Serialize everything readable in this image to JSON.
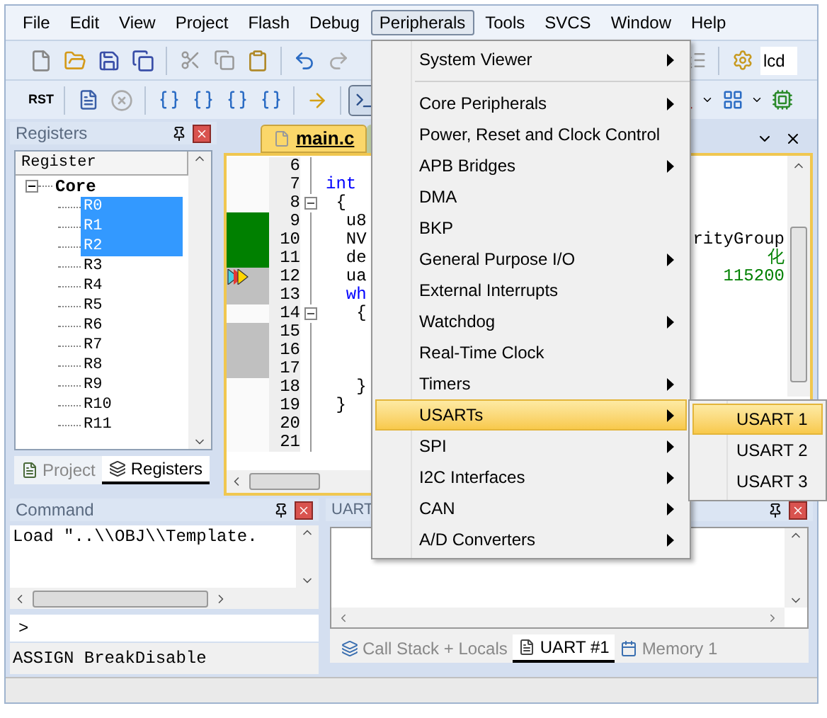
{
  "menu_bar": [
    {
      "label": "File",
      "open": false
    },
    {
      "label": "Edit",
      "open": false
    },
    {
      "label": "View",
      "open": false
    },
    {
      "label": "Project",
      "open": false
    },
    {
      "label": "Flash",
      "open": false
    },
    {
      "label": "Debug",
      "open": false
    },
    {
      "label": "Peripherals",
      "open": true
    },
    {
      "label": "Tools",
      "open": false
    },
    {
      "label": "SVCS",
      "open": false
    },
    {
      "label": "Window",
      "open": false
    },
    {
      "label": "Help",
      "open": false
    }
  ],
  "toolbar": {
    "reset_label": "RST",
    "target_field": {
      "value": "lcd"
    }
  },
  "registers_panel": {
    "title": "Registers",
    "column": "Register",
    "tree": [
      {
        "label": "Core",
        "expanded": true,
        "children": [
          {
            "label": "R0",
            "selected": true
          },
          {
            "label": "R1",
            "selected": true
          },
          {
            "label": "R2",
            "selected": true
          },
          {
            "label": "R3",
            "selected": false
          },
          {
            "label": "R4",
            "selected": false
          },
          {
            "label": "R5",
            "selected": false
          },
          {
            "label": "R6",
            "selected": false
          },
          {
            "label": "R7",
            "selected": false
          },
          {
            "label": "R8",
            "selected": false
          },
          {
            "label": "R9",
            "selected": false
          },
          {
            "label": "R10",
            "selected": false
          },
          {
            "label": "R11",
            "selected": false
          }
        ]
      }
    ],
    "tabs": [
      {
        "label": "Project",
        "selected": false
      },
      {
        "label": "Registers",
        "selected": true
      }
    ]
  },
  "editor": {
    "tabs": [
      {
        "label": "main.c",
        "selected": true
      }
    ],
    "lines": [
      {
        "number": "6",
        "executed": false,
        "skipped": false,
        "current": false
      },
      {
        "number": "7",
        "code": "int",
        "kind": "keyword",
        "executed": false,
        "skipped": false,
        "current": false
      },
      {
        "number": "8",
        "code": " {",
        "fold": true,
        "executed": false,
        "skipped": false,
        "current": false
      },
      {
        "number": "9",
        "code": "  u8",
        "executed": true,
        "skipped": false,
        "current": false
      },
      {
        "number": "10",
        "code": "  NV",
        "executed": true,
        "skipped": false,
        "current": false,
        "tail": {
          "text": "rityGroup",
          "kind": "plain"
        }
      },
      {
        "number": "11",
        "code": "  de",
        "executed": true,
        "skipped": false,
        "current": false,
        "tail": {
          "text": "化",
          "kind": "comment"
        }
      },
      {
        "number": "12",
        "code": "  ua",
        "executed": false,
        "skipped": true,
        "current": true,
        "tail": {
          "text": "115200",
          "kind": "comment"
        }
      },
      {
        "number": "13",
        "code": "  wh",
        "kind": "keyword",
        "executed": false,
        "skipped": true,
        "current": false
      },
      {
        "number": "14",
        "code": "   {",
        "fold": true,
        "executed": false,
        "skipped": false,
        "current": false
      },
      {
        "number": "15",
        "executed": false,
        "skipped": true,
        "current": false
      },
      {
        "number": "16",
        "executed": false,
        "skipped": true,
        "current": false
      },
      {
        "number": "17",
        "executed": false,
        "skipped": true,
        "current": false
      },
      {
        "number": "18",
        "code": "   }",
        "executed": false,
        "skipped": false,
        "current": false
      },
      {
        "number": "19",
        "code": " }",
        "executed": false,
        "skipped": false,
        "current": false
      },
      {
        "number": "20",
        "executed": false,
        "skipped": false,
        "current": false
      },
      {
        "number": "21",
        "executed": false,
        "skipped": false,
        "current": false
      }
    ]
  },
  "command_panel": {
    "title": "Command",
    "output": "Load \"..\\\\OBJ\\\\Template.",
    "prompt": ">",
    "hint": "ASSIGN BreakDisable"
  },
  "uart_panel": {
    "title": "UART",
    "tabs": [
      {
        "label": "Call Stack + Locals",
        "selected": false
      },
      {
        "label": "UART #1",
        "selected": true
      },
      {
        "label": "Memory 1",
        "selected": false
      }
    ]
  },
  "peripherals_menu": {
    "items": [
      {
        "label": "System Viewer",
        "submenu": true,
        "selected": false,
        "separator_after": true
      },
      {
        "label": "Core Peripherals",
        "submenu": true,
        "selected": false
      },
      {
        "label": "Power, Reset and Clock Control",
        "submenu": false,
        "selected": false
      },
      {
        "label": "APB Bridges",
        "submenu": true,
        "selected": false
      },
      {
        "label": "DMA",
        "submenu": false,
        "selected": false
      },
      {
        "label": "BKP",
        "submenu": false,
        "selected": false
      },
      {
        "label": "General Purpose I/O",
        "submenu": true,
        "selected": false
      },
      {
        "label": "External Interrupts",
        "submenu": false,
        "selected": false
      },
      {
        "label": "Watchdog",
        "submenu": true,
        "selected": false
      },
      {
        "label": "Real-Time Clock",
        "submenu": false,
        "selected": false
      },
      {
        "label": "Timers",
        "submenu": true,
        "selected": false
      },
      {
        "label": "USARTs",
        "submenu": true,
        "selected": true
      },
      {
        "label": "SPI",
        "submenu": true,
        "selected": false
      },
      {
        "label": "I2C Interfaces",
        "submenu": true,
        "selected": false
      },
      {
        "label": "CAN",
        "submenu": true,
        "selected": false
      },
      {
        "label": "A/D Converters",
        "submenu": true,
        "selected": false
      }
    ],
    "submenu": [
      {
        "label": "USART 1",
        "selected": true
      },
      {
        "label": "USART 2",
        "selected": false
      },
      {
        "label": "USART 3",
        "selected": false
      }
    ]
  }
}
